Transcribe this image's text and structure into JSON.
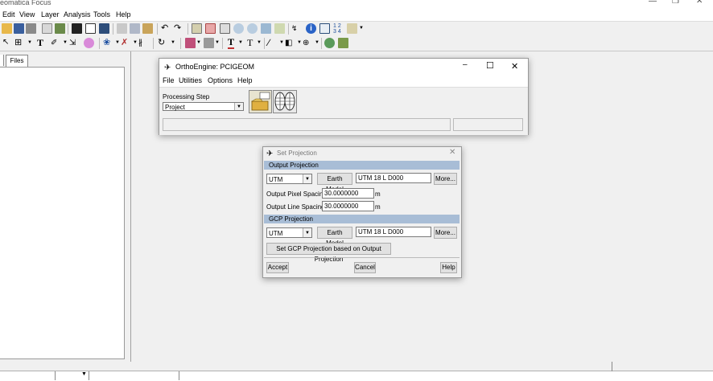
{
  "app": {
    "title": "eomatica Focus",
    "menu": [
      "Edit",
      "View",
      "Layer",
      "Analysis",
      "Tools",
      "Help"
    ],
    "left_tab": "Files"
  },
  "ortho": {
    "title": "OrthoEngine: PCIGEOM",
    "menu": [
      "File",
      "Utilities",
      "Options",
      "Help"
    ],
    "processing_step_label": "Processing Step",
    "processing_step_value": "Project"
  },
  "set_projection": {
    "title": "Set Projection",
    "output_section": "Output Projection",
    "output_proj": "UTM",
    "earth_model_label": "Earth Model",
    "output_proj_detail": "UTM     18 L D000",
    "more_label": "More...",
    "pixel_spacing_label": "Output Pixel Spacing:",
    "pixel_spacing_value": "30.0000000",
    "line_spacing_label": "Output  Line Spacing:",
    "line_spacing_value": "30.0000000",
    "unit": "m",
    "gcp_section": "GCP Projection",
    "gcp_proj": "UTM",
    "gcp_proj_detail": "UTM     18 L D000",
    "gcp_based_button": "Set GCP Projection based on Output Projection",
    "accept": "Accept",
    "cancel": "Cancel",
    "help": "Help"
  }
}
